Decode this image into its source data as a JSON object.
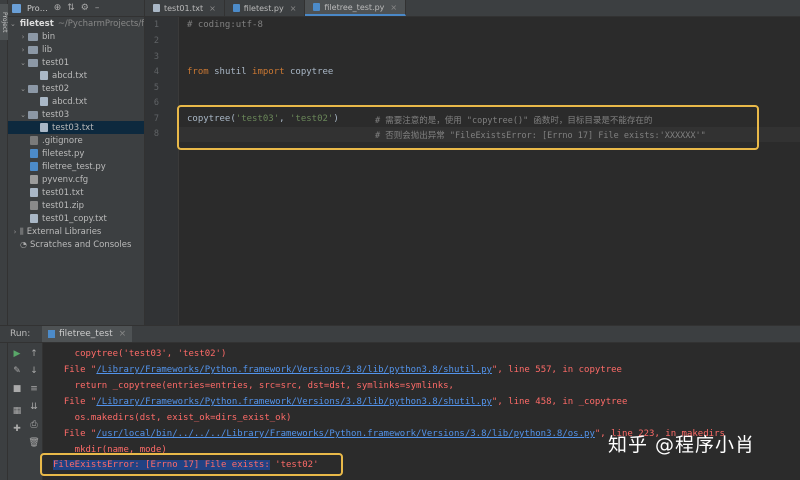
{
  "project_panel": {
    "title": "Pro…",
    "root": {
      "name": "filetest",
      "path": "~/PycharmProjects/f"
    },
    "items": [
      {
        "label": "bin",
        "type": "folder",
        "arrow": "›"
      },
      {
        "label": "lib",
        "type": "folder",
        "arrow": "›"
      },
      {
        "label": "test01",
        "type": "folder",
        "arrow": "⌄"
      },
      {
        "label": "abcd.txt",
        "type": "txt"
      },
      {
        "label": "test02",
        "type": "folder",
        "arrow": "⌄"
      },
      {
        "label": "abcd.txt",
        "type": "txt"
      },
      {
        "label": "test03",
        "type": "folder",
        "arrow": "⌄"
      },
      {
        "label": "test03.txt",
        "type": "txt"
      },
      {
        "label": ".gitignore",
        "type": "gi"
      },
      {
        "label": "filetest.py",
        "type": "py"
      },
      {
        "label": "filetree_test.py",
        "type": "py"
      },
      {
        "label": "pyvenv.cfg",
        "type": "cfg"
      },
      {
        "label": "test01.txt",
        "type": "txt"
      },
      {
        "label": "test01.zip",
        "type": "zip"
      },
      {
        "label": "test01_copy.txt",
        "type": "txt"
      },
      {
        "label": "External Libraries",
        "type": "lib",
        "arrow": "›"
      },
      {
        "label": "Scratches and Consoles",
        "type": "scratch"
      }
    ],
    "left_tab": "Project",
    "left_tab_bottom": "Structure"
  },
  "tabs": [
    {
      "label": "test01.txt"
    },
    {
      "label": "filetest.py"
    },
    {
      "label": "filetree_test.py",
      "active": true
    }
  ],
  "editor": {
    "line_numbers": [
      "1",
      "2",
      "3",
      "4",
      "5",
      "6",
      "7",
      "8"
    ],
    "line1": "# coding:utf-8",
    "line4_kw1": "from",
    "line4_mid": " shutil ",
    "line4_kw2": "import",
    "line4_end": " copytree",
    "line7_fn": "copytree(",
    "line7_s1": "'test03'",
    "line7_sep": ", ",
    "line7_s2": "'test02'",
    "line7_close": ")",
    "line7_cmt": "# 需要注意的是，使用 \"copytree()\" 函数时，目标目录是不能存在的",
    "line8_cmt": "# 否则会抛出异常 \"FileExistsError: [Errno 17] File exists:'XXXXXX'\""
  },
  "run": {
    "label": "Run:",
    "tab": "filetree_test",
    "lines": [
      {
        "pre": "    copytree('test03', 'test02')"
      },
      {
        "pre": "  File \"",
        "link": "/Library/Frameworks/Python.framework/Versions/3.8/lib/python3.8/shutil.py",
        "post": "\", line 557, in copytree"
      },
      {
        "pre": "    return _copytree(entries=entries, src=src, dst=dst, symlinks=symlinks,"
      },
      {
        "pre": "  File \"",
        "link": "/Library/Frameworks/Python.framework/Versions/3.8/lib/python3.8/shutil.py",
        "post": "\", line 458, in _copytree"
      },
      {
        "pre": "    os.makedirs(dst, exist_ok=dirs_exist_ok)"
      },
      {
        "pre": "  File \"",
        "link": "/usr/local/bin/../../../Library/Frameworks/Python.framework/Versions/3.8/lib/python3.8/os.py",
        "post": "\", line 223, in makedirs"
      },
      {
        "pre": "    mkdir(name, mode)"
      }
    ],
    "error_sel": "FileExistsError: [Errno 17] File exists:",
    "error_tail": " 'test02'"
  },
  "watermark": "知乎 @程序小肖",
  "colors": {
    "highlight_box": "#e9b949",
    "keyword": "#cc7832",
    "string": "#6a8759",
    "comment": "#808080",
    "error": "#ff6b68",
    "link": "#5394ec"
  }
}
